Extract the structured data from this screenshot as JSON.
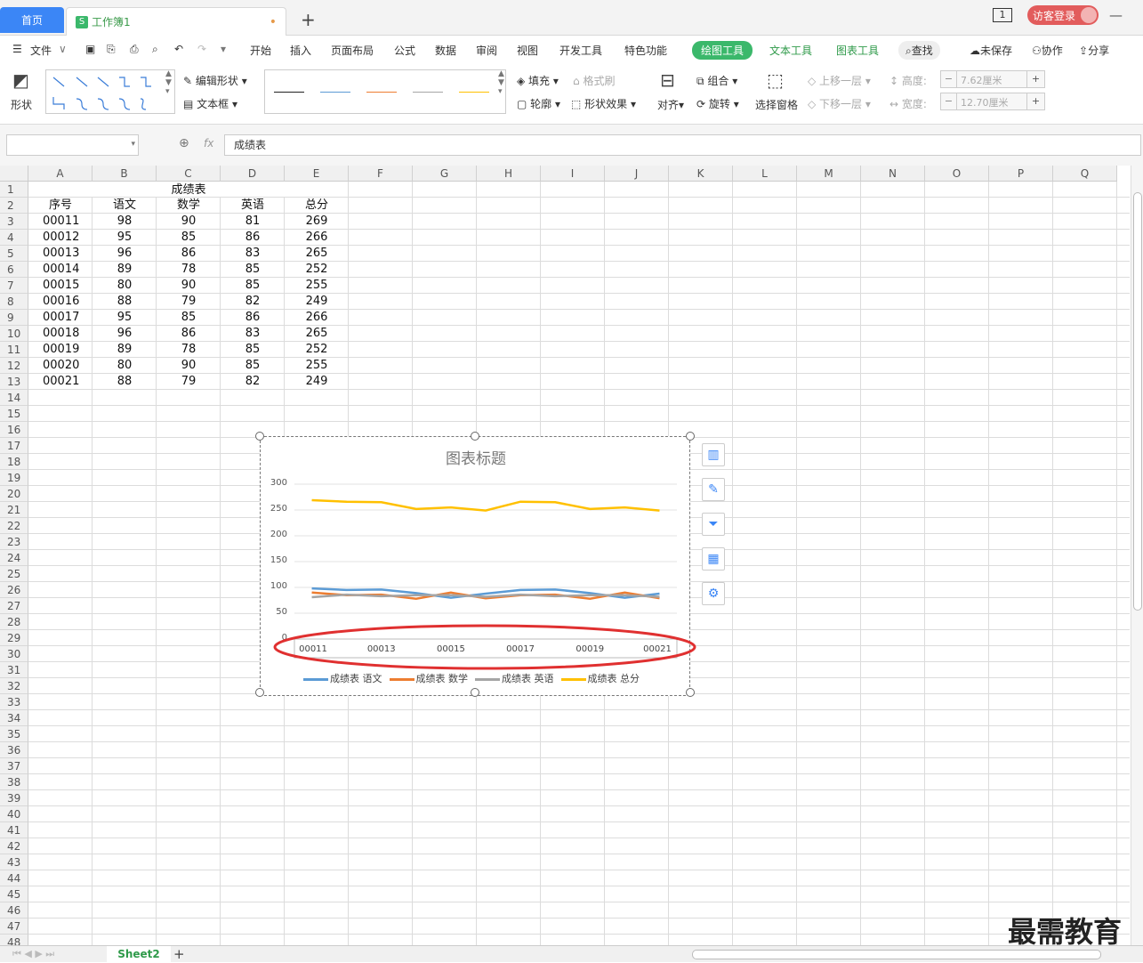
{
  "tabs": {
    "home": "首页",
    "doc": "工作簿1",
    "doc_dot": "•",
    "add": "+"
  },
  "title_right": {
    "page_indicator": "1",
    "login": "访客登录"
  },
  "menu": {
    "items": [
      "文件",
      "开始",
      "插入",
      "页面布局",
      "公式",
      "数据",
      "审阅",
      "视图",
      "开发工具",
      "特色功能"
    ],
    "tools": [
      "绘图工具",
      "文本工具",
      "图表工具"
    ],
    "search": "查找",
    "unsaved": "未保存",
    "collab": "协作",
    "share": "分享"
  },
  "ribbon": {
    "shape": "形状",
    "edit_shape": "编辑形状",
    "textbox": "文本框",
    "fill": "填充",
    "format_brush": "格式刷",
    "outline": "轮廓",
    "shape_effect": "形状效果",
    "align": "对齐",
    "group": "组合",
    "rotate": "旋转",
    "select_pane": "选择窗格",
    "bring_forward": "上移一层",
    "send_backward": "下移一层",
    "height_label": "高度:",
    "width_label": "宽度:",
    "height_value": "7.62厘米",
    "width_value": "12.70厘米",
    "line_colors": [
      "#222222",
      "#5b9bd5",
      "#ed7d31",
      "#a5a5a5",
      "#ffc000"
    ]
  },
  "formula": {
    "fx": "fx",
    "content": "成绩表"
  },
  "columns": [
    "A",
    "B",
    "C",
    "D",
    "E",
    "F",
    "G",
    "H",
    "I",
    "J",
    "K",
    "L",
    "M",
    "N",
    "O",
    "P",
    "Q"
  ],
  "rows": [
    "1",
    "2",
    "3",
    "4",
    "5",
    "6",
    "7",
    "8",
    "9",
    "10",
    "11",
    "12",
    "13",
    "14",
    "15",
    "16",
    "17",
    "18",
    "19",
    "20",
    "21",
    "22",
    "23",
    "24",
    "25",
    "26",
    "27",
    "28",
    "29",
    "30",
    "31",
    "32",
    "33",
    "34",
    "35",
    "36",
    "37",
    "38",
    "39",
    "40",
    "41",
    "42",
    "43",
    "44",
    "45",
    "46",
    "47",
    "48"
  ],
  "table": {
    "title": "成绩表",
    "headers": [
      "序号",
      "语文",
      "数学",
      "英语",
      "总分"
    ],
    "rows": [
      [
        "00011",
        "98",
        "90",
        "81",
        "269"
      ],
      [
        "00012",
        "95",
        "85",
        "86",
        "266"
      ],
      [
        "00013",
        "96",
        "86",
        "83",
        "265"
      ],
      [
        "00014",
        "89",
        "78",
        "85",
        "252"
      ],
      [
        "00015",
        "80",
        "90",
        "85",
        "255"
      ],
      [
        "00016",
        "88",
        "79",
        "82",
        "249"
      ],
      [
        "00017",
        "95",
        "85",
        "86",
        "266"
      ],
      [
        "00018",
        "96",
        "86",
        "83",
        "265"
      ],
      [
        "00019",
        "89",
        "78",
        "85",
        "252"
      ],
      [
        "00020",
        "80",
        "90",
        "85",
        "255"
      ],
      [
        "00021",
        "88",
        "79",
        "82",
        "249"
      ]
    ]
  },
  "chart_data": {
    "type": "line",
    "title": "图表标题",
    "categories": [
      "00011",
      "00012",
      "00013",
      "00014",
      "00015",
      "00016",
      "00017",
      "00018",
      "00019",
      "00020",
      "00021"
    ],
    "x_tick_labels": [
      "00011",
      "00013",
      "00015",
      "00017",
      "00019",
      "00021"
    ],
    "ylim": [
      0,
      300
    ],
    "y_ticks": [
      "300",
      "250",
      "200",
      "150",
      "100",
      "50",
      "0"
    ],
    "legend": "bottom",
    "series": [
      {
        "name": "成绩表 语文",
        "color": "#5b9bd5",
        "values": [
          98,
          95,
          96,
          89,
          80,
          88,
          95,
          96,
          89,
          80,
          88
        ]
      },
      {
        "name": "成绩表 数学",
        "color": "#ed7d31",
        "values": [
          90,
          85,
          86,
          78,
          90,
          79,
          85,
          86,
          78,
          90,
          79
        ]
      },
      {
        "name": "成绩表 英语",
        "color": "#a5a5a5",
        "values": [
          81,
          86,
          83,
          85,
          85,
          82,
          86,
          83,
          85,
          85,
          82
        ]
      },
      {
        "name": "成绩表 总分",
        "color": "#ffc000",
        "values": [
          269,
          266,
          265,
          252,
          255,
          249,
          266,
          265,
          252,
          255,
          249
        ]
      }
    ],
    "annotation_color": "#e03030"
  },
  "sheet": {
    "name": "Sheet2",
    "add": "+"
  },
  "watermark": "最需教育"
}
